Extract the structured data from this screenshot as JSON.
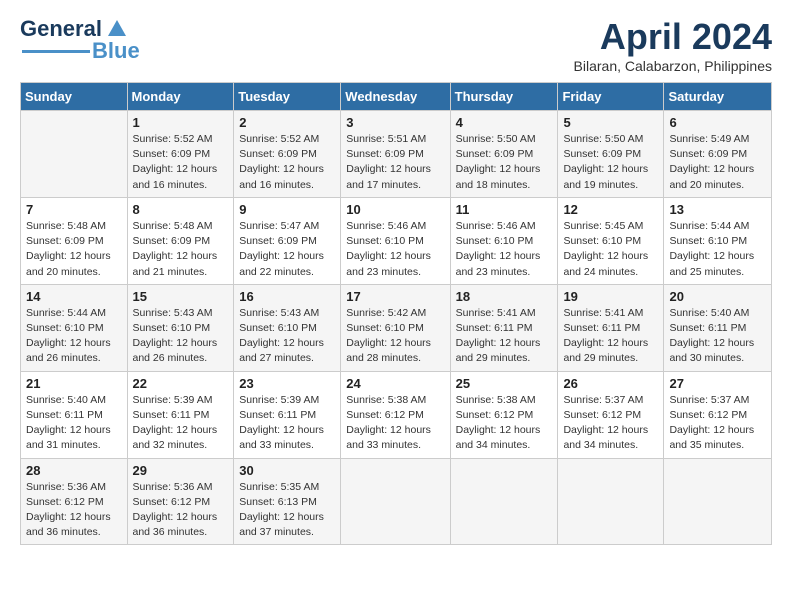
{
  "header": {
    "logo_general": "General",
    "logo_blue": "Blue",
    "month_year": "April 2024",
    "location": "Bilaran, Calabarzon, Philippines"
  },
  "days_of_week": [
    "Sunday",
    "Monday",
    "Tuesday",
    "Wednesday",
    "Thursday",
    "Friday",
    "Saturday"
  ],
  "weeks": [
    [
      {
        "day": "",
        "sunrise": "",
        "sunset": "",
        "daylight": ""
      },
      {
        "day": "1",
        "sunrise": "Sunrise: 5:52 AM",
        "sunset": "Sunset: 6:09 PM",
        "daylight": "Daylight: 12 hours and 16 minutes."
      },
      {
        "day": "2",
        "sunrise": "Sunrise: 5:52 AM",
        "sunset": "Sunset: 6:09 PM",
        "daylight": "Daylight: 12 hours and 16 minutes."
      },
      {
        "day": "3",
        "sunrise": "Sunrise: 5:51 AM",
        "sunset": "Sunset: 6:09 PM",
        "daylight": "Daylight: 12 hours and 17 minutes."
      },
      {
        "day": "4",
        "sunrise": "Sunrise: 5:50 AM",
        "sunset": "Sunset: 6:09 PM",
        "daylight": "Daylight: 12 hours and 18 minutes."
      },
      {
        "day": "5",
        "sunrise": "Sunrise: 5:50 AM",
        "sunset": "Sunset: 6:09 PM",
        "daylight": "Daylight: 12 hours and 19 minutes."
      },
      {
        "day": "6",
        "sunrise": "Sunrise: 5:49 AM",
        "sunset": "Sunset: 6:09 PM",
        "daylight": "Daylight: 12 hours and 20 minutes."
      }
    ],
    [
      {
        "day": "7",
        "sunrise": "Sunrise: 5:48 AM",
        "sunset": "Sunset: 6:09 PM",
        "daylight": "Daylight: 12 hours and 20 minutes."
      },
      {
        "day": "8",
        "sunrise": "Sunrise: 5:48 AM",
        "sunset": "Sunset: 6:09 PM",
        "daylight": "Daylight: 12 hours and 21 minutes."
      },
      {
        "day": "9",
        "sunrise": "Sunrise: 5:47 AM",
        "sunset": "Sunset: 6:09 PM",
        "daylight": "Daylight: 12 hours and 22 minutes."
      },
      {
        "day": "10",
        "sunrise": "Sunrise: 5:46 AM",
        "sunset": "Sunset: 6:10 PM",
        "daylight": "Daylight: 12 hours and 23 minutes."
      },
      {
        "day": "11",
        "sunrise": "Sunrise: 5:46 AM",
        "sunset": "Sunset: 6:10 PM",
        "daylight": "Daylight: 12 hours and 23 minutes."
      },
      {
        "day": "12",
        "sunrise": "Sunrise: 5:45 AM",
        "sunset": "Sunset: 6:10 PM",
        "daylight": "Daylight: 12 hours and 24 minutes."
      },
      {
        "day": "13",
        "sunrise": "Sunrise: 5:44 AM",
        "sunset": "Sunset: 6:10 PM",
        "daylight": "Daylight: 12 hours and 25 minutes."
      }
    ],
    [
      {
        "day": "14",
        "sunrise": "Sunrise: 5:44 AM",
        "sunset": "Sunset: 6:10 PM",
        "daylight": "Daylight: 12 hours and 26 minutes."
      },
      {
        "day": "15",
        "sunrise": "Sunrise: 5:43 AM",
        "sunset": "Sunset: 6:10 PM",
        "daylight": "Daylight: 12 hours and 26 minutes."
      },
      {
        "day": "16",
        "sunrise": "Sunrise: 5:43 AM",
        "sunset": "Sunset: 6:10 PM",
        "daylight": "Daylight: 12 hours and 27 minutes."
      },
      {
        "day": "17",
        "sunrise": "Sunrise: 5:42 AM",
        "sunset": "Sunset: 6:10 PM",
        "daylight": "Daylight: 12 hours and 28 minutes."
      },
      {
        "day": "18",
        "sunrise": "Sunrise: 5:41 AM",
        "sunset": "Sunset: 6:11 PM",
        "daylight": "Daylight: 12 hours and 29 minutes."
      },
      {
        "day": "19",
        "sunrise": "Sunrise: 5:41 AM",
        "sunset": "Sunset: 6:11 PM",
        "daylight": "Daylight: 12 hours and 29 minutes."
      },
      {
        "day": "20",
        "sunrise": "Sunrise: 5:40 AM",
        "sunset": "Sunset: 6:11 PM",
        "daylight": "Daylight: 12 hours and 30 minutes."
      }
    ],
    [
      {
        "day": "21",
        "sunrise": "Sunrise: 5:40 AM",
        "sunset": "Sunset: 6:11 PM",
        "daylight": "Daylight: 12 hours and 31 minutes."
      },
      {
        "day": "22",
        "sunrise": "Sunrise: 5:39 AM",
        "sunset": "Sunset: 6:11 PM",
        "daylight": "Daylight: 12 hours and 32 minutes."
      },
      {
        "day": "23",
        "sunrise": "Sunrise: 5:39 AM",
        "sunset": "Sunset: 6:11 PM",
        "daylight": "Daylight: 12 hours and 33 minutes."
      },
      {
        "day": "24",
        "sunrise": "Sunrise: 5:38 AM",
        "sunset": "Sunset: 6:12 PM",
        "daylight": "Daylight: 12 hours and 33 minutes."
      },
      {
        "day": "25",
        "sunrise": "Sunrise: 5:38 AM",
        "sunset": "Sunset: 6:12 PM",
        "daylight": "Daylight: 12 hours and 34 minutes."
      },
      {
        "day": "26",
        "sunrise": "Sunrise: 5:37 AM",
        "sunset": "Sunset: 6:12 PM",
        "daylight": "Daylight: 12 hours and 34 minutes."
      },
      {
        "day": "27",
        "sunrise": "Sunrise: 5:37 AM",
        "sunset": "Sunset: 6:12 PM",
        "daylight": "Daylight: 12 hours and 35 minutes."
      }
    ],
    [
      {
        "day": "28",
        "sunrise": "Sunrise: 5:36 AM",
        "sunset": "Sunset: 6:12 PM",
        "daylight": "Daylight: 12 hours and 36 minutes."
      },
      {
        "day": "29",
        "sunrise": "Sunrise: 5:36 AM",
        "sunset": "Sunset: 6:12 PM",
        "daylight": "Daylight: 12 hours and 36 minutes."
      },
      {
        "day": "30",
        "sunrise": "Sunrise: 5:35 AM",
        "sunset": "Sunset: 6:13 PM",
        "daylight": "Daylight: 12 hours and 37 minutes."
      },
      {
        "day": "",
        "sunrise": "",
        "sunset": "",
        "daylight": ""
      },
      {
        "day": "",
        "sunrise": "",
        "sunset": "",
        "daylight": ""
      },
      {
        "day": "",
        "sunrise": "",
        "sunset": "",
        "daylight": ""
      },
      {
        "day": "",
        "sunrise": "",
        "sunset": "",
        "daylight": ""
      }
    ]
  ]
}
